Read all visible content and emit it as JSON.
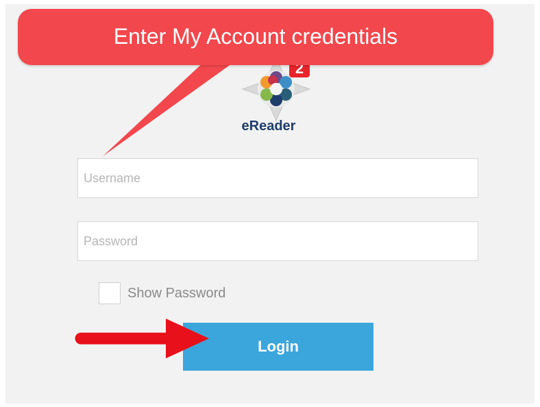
{
  "callout": {
    "text": "Enter My Account credentials"
  },
  "logo": {
    "badge": "2",
    "brand": "eReader"
  },
  "form": {
    "username_placeholder": "Username",
    "password_placeholder": "Password",
    "show_password_label": "Show Password",
    "login_label": "Login"
  },
  "colors": {
    "callout": "#f2474c",
    "arrow": "#e8101a",
    "login_button": "#3ba6dc",
    "brand_text": "#1f3d6b",
    "panel_bg": "#f2f2f2"
  },
  "icons": {
    "logo": "flower-compass-icon",
    "pointer": "arrow-right-icon"
  }
}
